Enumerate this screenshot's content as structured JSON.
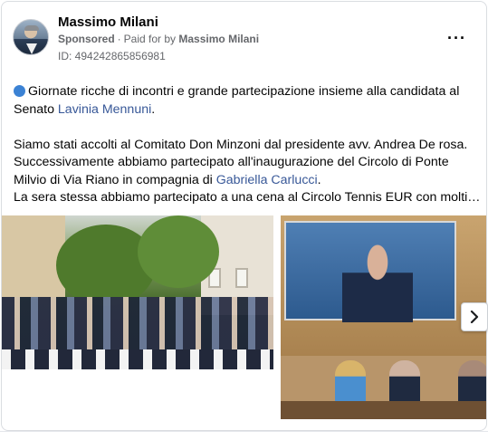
{
  "post": {
    "author": "Massimo Milani",
    "sponsored_label": "Sponsored",
    "paid_for_prefix": "Paid for by",
    "paid_for_name": "Massimo Milani",
    "ad_id": "ID: 494242865856981",
    "more_icon": "more-horizontal-icon"
  },
  "text": {
    "line1_before": "Giornate ricche di incontri e grande partecipazione insieme alla candidata al Senato ",
    "line1_link": "Lavinia Mennuni",
    "line1_after": ".",
    "para2_a": "Siamo stati accolti al Comitato Don Minzoni dal presidente avv. Andrea De rosa. Successivamente abbiamo partecipato all'inaugurazione del Circolo di Ponte Milvio di Via Riano in compagnia di ",
    "para2_link": "Gabriella Carlucci",
    "para2_after": ".",
    "para3": "La sera stessa abbiamo partecipato a una cena al Circolo Tennis EUR con molti…"
  },
  "colors": {
    "link": "#385898",
    "dot": "#3b82d4"
  }
}
